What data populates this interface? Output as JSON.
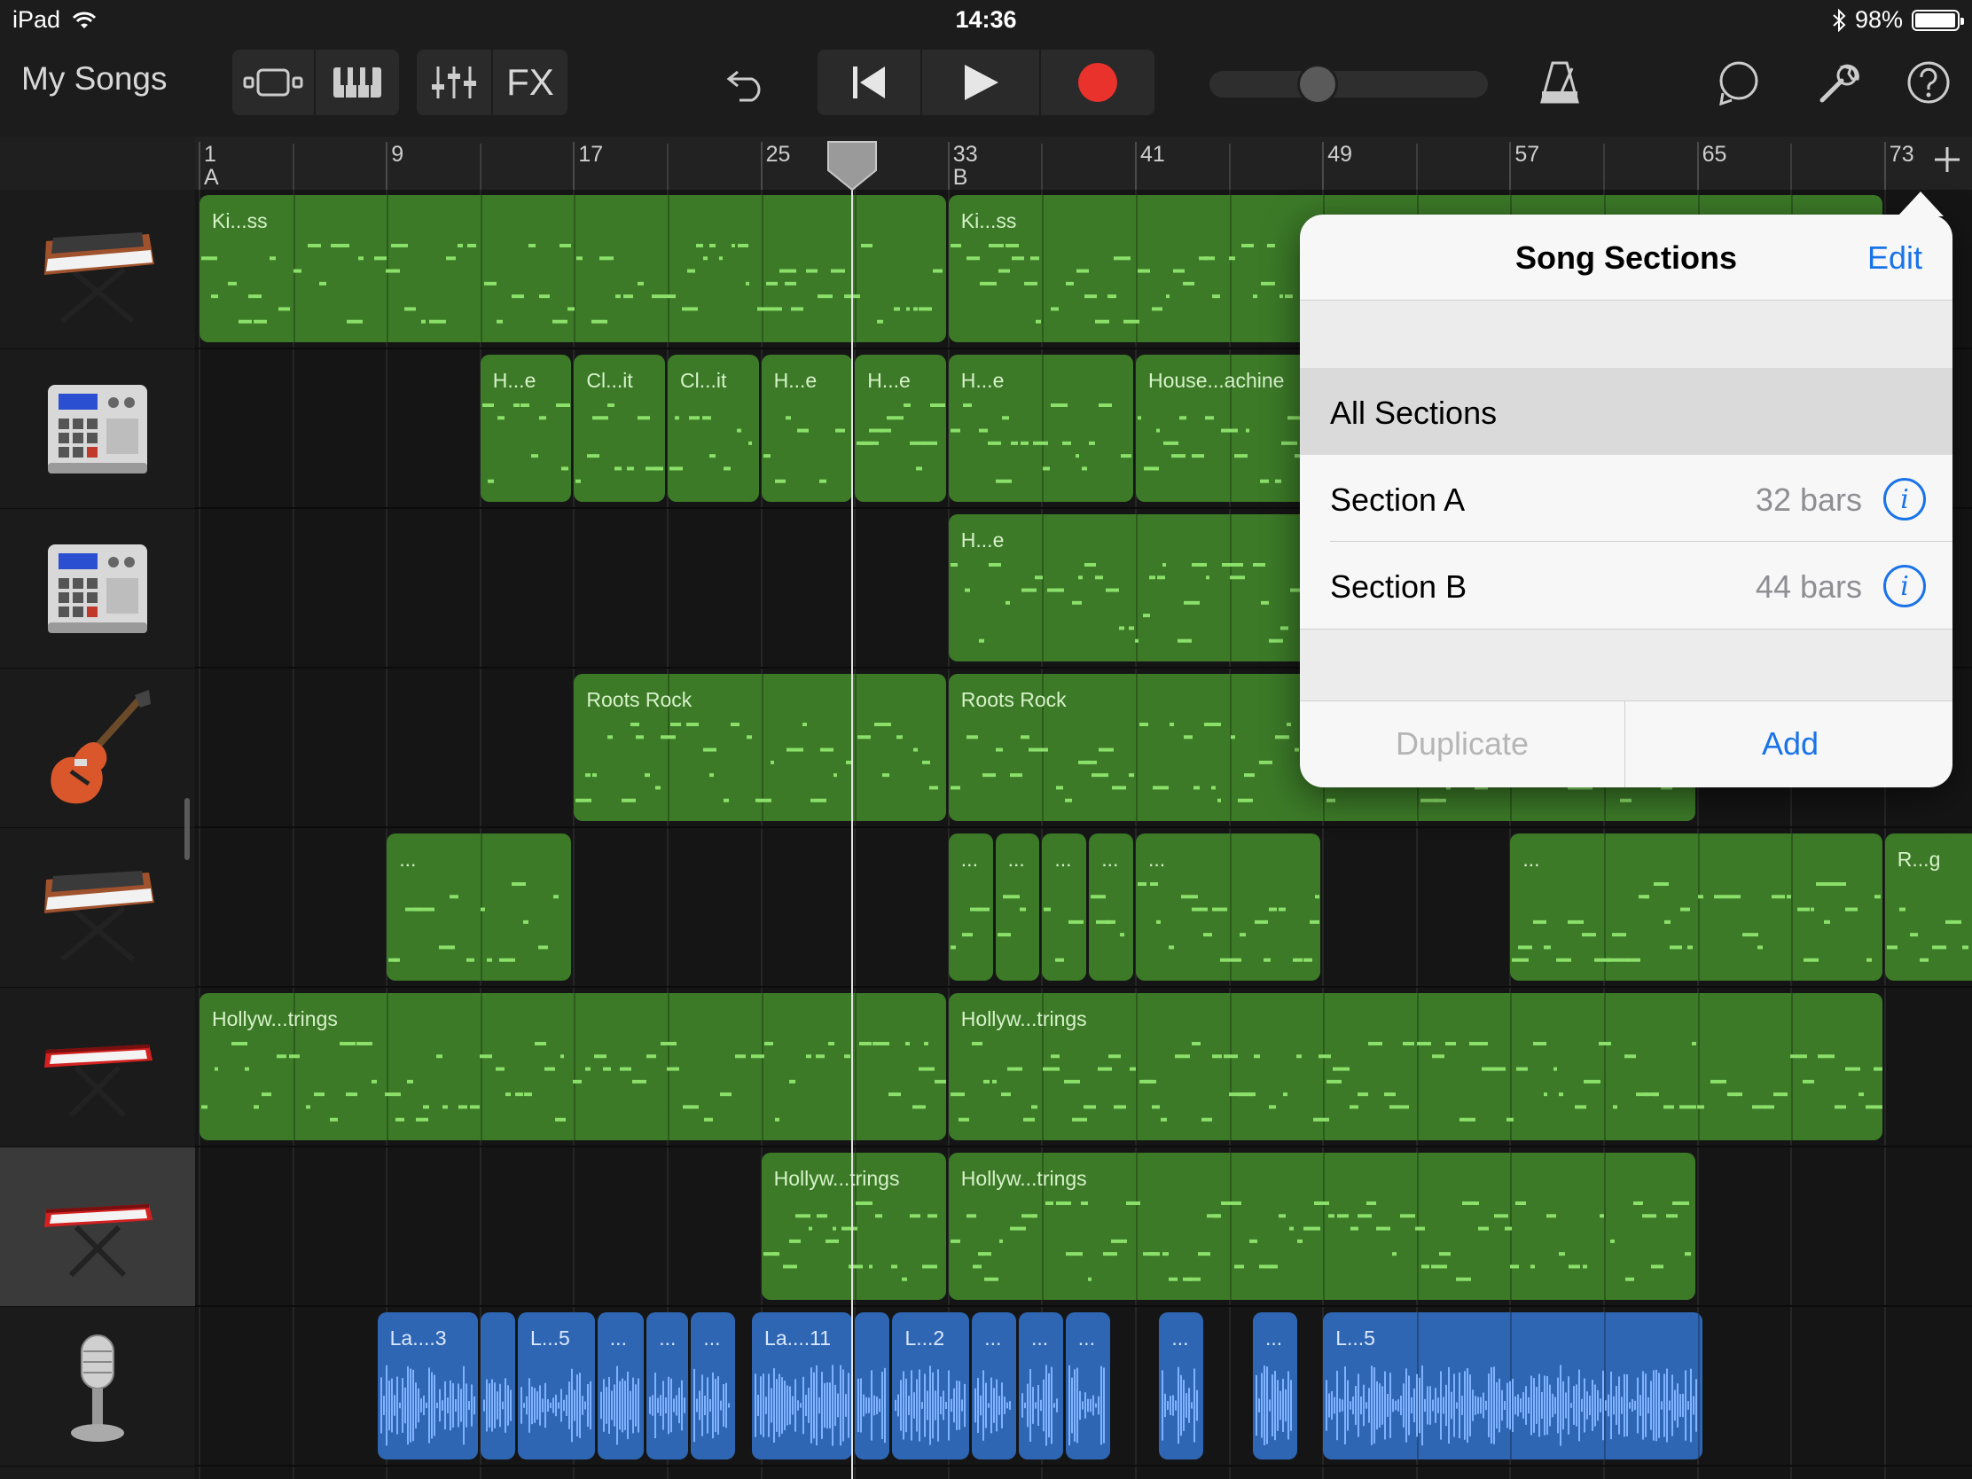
{
  "status_bar": {
    "device": "iPad",
    "time": "14:36",
    "battery": "98%",
    "battery_level": 0.98
  },
  "toolbar": {
    "my_songs": "My Songs",
    "fx": "FX",
    "tempo_slider_position": 0.39
  },
  "ruler": {
    "bars": [
      "1",
      "9",
      "17",
      "25",
      "33",
      "41",
      "49",
      "57",
      "65",
      "73"
    ],
    "section_markers": [
      {
        "bar": "1",
        "letter": "A"
      },
      {
        "bar": "33",
        "letter": "B"
      }
    ]
  },
  "tracks": [
    {
      "instrument": "synth-keyboard-icon",
      "regions": [
        {
          "label": "Ki...ss",
          "start": 1,
          "length": 32,
          "color": "green"
        },
        {
          "label": "Ki...ss",
          "start": 33,
          "length": 40,
          "color": "green"
        }
      ]
    },
    {
      "instrument": "drum-machine-icon",
      "regions": [
        {
          "label": "H...e",
          "start": 13,
          "length": 4,
          "color": "green"
        },
        {
          "label": "Cl...it",
          "start": 17,
          "length": 4,
          "color": "green"
        },
        {
          "label": "Cl...it",
          "start": 21,
          "length": 4,
          "color": "green"
        },
        {
          "label": "H...e",
          "start": 25,
          "length": 4,
          "color": "green"
        },
        {
          "label": "H...e",
          "start": 29,
          "length": 4,
          "color": "green"
        },
        {
          "label": "H...e",
          "start": 33,
          "length": 8,
          "color": "green"
        },
        {
          "label": "House...achine",
          "start": 41,
          "length": 8,
          "color": "green"
        }
      ]
    },
    {
      "instrument": "drum-machine-icon",
      "regions": [
        {
          "label": "H...e",
          "start": 33,
          "length": 16,
          "color": "green"
        }
      ]
    },
    {
      "instrument": "electric-guitar-icon",
      "regions": [
        {
          "label": "Roots Rock",
          "start": 17,
          "length": 16,
          "color": "green"
        },
        {
          "label": "Roots Rock",
          "start": 33,
          "length": 32,
          "color": "green"
        }
      ]
    },
    {
      "instrument": "synth-keyboard-icon",
      "regions": [
        {
          "label": "...",
          "start": 9,
          "length": 8,
          "color": "green"
        },
        {
          "label": "...",
          "start": 33,
          "length": 2,
          "color": "green"
        },
        {
          "label": "...",
          "start": 35,
          "length": 2,
          "color": "green"
        },
        {
          "label": "...",
          "start": 37,
          "length": 2,
          "color": "green"
        },
        {
          "label": "...",
          "start": 39,
          "length": 2,
          "color": "green"
        },
        {
          "label": "...",
          "start": 41,
          "length": 8,
          "color": "green"
        },
        {
          "label": "...",
          "start": 57,
          "length": 16,
          "color": "green"
        },
        {
          "label": "R...g",
          "start": 73,
          "length": 5,
          "color": "green"
        }
      ]
    },
    {
      "instrument": "red-keyboard-icon",
      "regions": [
        {
          "label": "Hollyw...trings",
          "start": 1,
          "length": 32,
          "color": "green"
        },
        {
          "label": "Hollyw...trings",
          "start": 33,
          "length": 40,
          "color": "green"
        }
      ]
    },
    {
      "instrument": "red-keyboard-icon",
      "selected": true,
      "regions": [
        {
          "label": "Hollyw...trings",
          "start": 25,
          "length": 8,
          "color": "green"
        },
        {
          "label": "Hollyw...trings",
          "start": 33,
          "length": 32,
          "color": "green"
        }
      ]
    },
    {
      "instrument": "microphone-icon",
      "regions": [
        {
          "label": "La....3",
          "start": 8.6,
          "length": 4.4,
          "color": "blue"
        },
        {
          "label": "",
          "start": 13,
          "length": 1.6,
          "color": "blue"
        },
        {
          "label": "L...5",
          "start": 14.6,
          "length": 3.4,
          "color": "blue"
        },
        {
          "label": "...",
          "start": 18,
          "length": 2.1,
          "color": "blue"
        },
        {
          "label": "...",
          "start": 20.1,
          "length": 1.9,
          "color": "blue"
        },
        {
          "label": "...",
          "start": 22,
          "length": 2,
          "color": "blue"
        },
        {
          "label": "La....11",
          "start": 24.6,
          "length": 4.4,
          "color": "blue"
        },
        {
          "label": "",
          "start": 29,
          "length": 1.6,
          "color": "blue"
        },
        {
          "label": "L...2",
          "start": 30.6,
          "length": 3.4,
          "color": "blue"
        },
        {
          "label": "...",
          "start": 34,
          "length": 2,
          "color": "blue"
        },
        {
          "label": "...",
          "start": 36,
          "length": 2,
          "color": "blue"
        },
        {
          "label": "...",
          "start": 38,
          "length": 2,
          "color": "blue"
        },
        {
          "label": "...",
          "start": 42,
          "length": 2,
          "color": "blue"
        },
        {
          "label": "...",
          "start": 46,
          "length": 2,
          "color": "blue"
        },
        {
          "label": "L...5",
          "start": 49,
          "length": 16.3,
          "color": "blue"
        }
      ]
    }
  ],
  "playhead_bar": 28.9,
  "song_sections": {
    "title": "Song Sections",
    "edit": "Edit",
    "all_sections": "All Sections",
    "sections": [
      {
        "name": "Section A",
        "bars": "32 bars"
      },
      {
        "name": "Section B",
        "bars": "44 bars"
      }
    ],
    "duplicate": "Duplicate",
    "add": "Add"
  },
  "colors": {
    "midi_region": "#3c7a28",
    "audio_region": "#2f66b3",
    "record": "#e8322b",
    "link_blue": "#1a73e8"
  }
}
